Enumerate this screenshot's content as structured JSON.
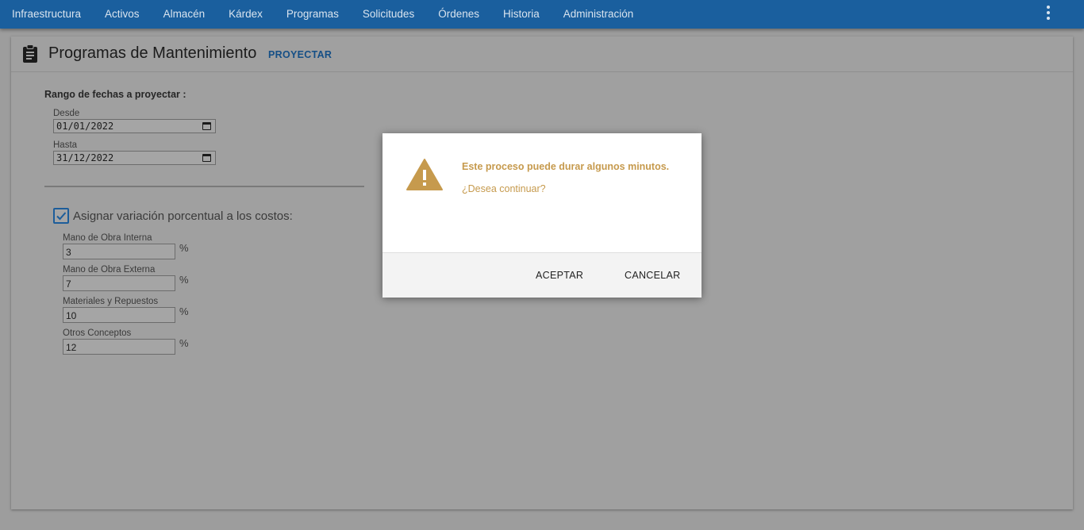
{
  "nav": {
    "items": [
      {
        "label": "Infraestructura"
      },
      {
        "label": "Activos"
      },
      {
        "label": "Almacén"
      },
      {
        "label": "Kárdex"
      },
      {
        "label": "Programas"
      },
      {
        "label": "Solicitudes"
      },
      {
        "label": "Órdenes"
      },
      {
        "label": "Historia"
      },
      {
        "label": "Administración"
      }
    ]
  },
  "header": {
    "title": "Programas de Mantenimiento",
    "action": "PROYECTAR"
  },
  "form": {
    "range_title": "Rango de fechas a proyectar :",
    "desde": {
      "label": "Desde",
      "value": "01/01/2022"
    },
    "hasta": {
      "label": "Hasta",
      "value": "31/12/2022"
    },
    "checkbox_label": "Asignar variación porcentual a los costos:",
    "checkbox_checked": true,
    "costs": [
      {
        "label": "Mano de Obra Interna",
        "value": "3",
        "unit": "%"
      },
      {
        "label": "Mano de Obra Externa",
        "value": "7",
        "unit": "%"
      },
      {
        "label": "Materiales y Repuestos",
        "value": "10",
        "unit": "%"
      },
      {
        "label": "Otros Conceptos",
        "value": "12",
        "unit": "%"
      }
    ]
  },
  "modal": {
    "message": "Este proceso puede durar algunos minutos.",
    "question": "¿Desea continuar?",
    "accept_label": "ACEPTAR",
    "cancel_label": "CANCELAR",
    "icon": "warning-icon",
    "accent_color": "#c69a4d"
  },
  "colors": {
    "nav_bg": "#1a5f9e",
    "link": "#154f86"
  }
}
